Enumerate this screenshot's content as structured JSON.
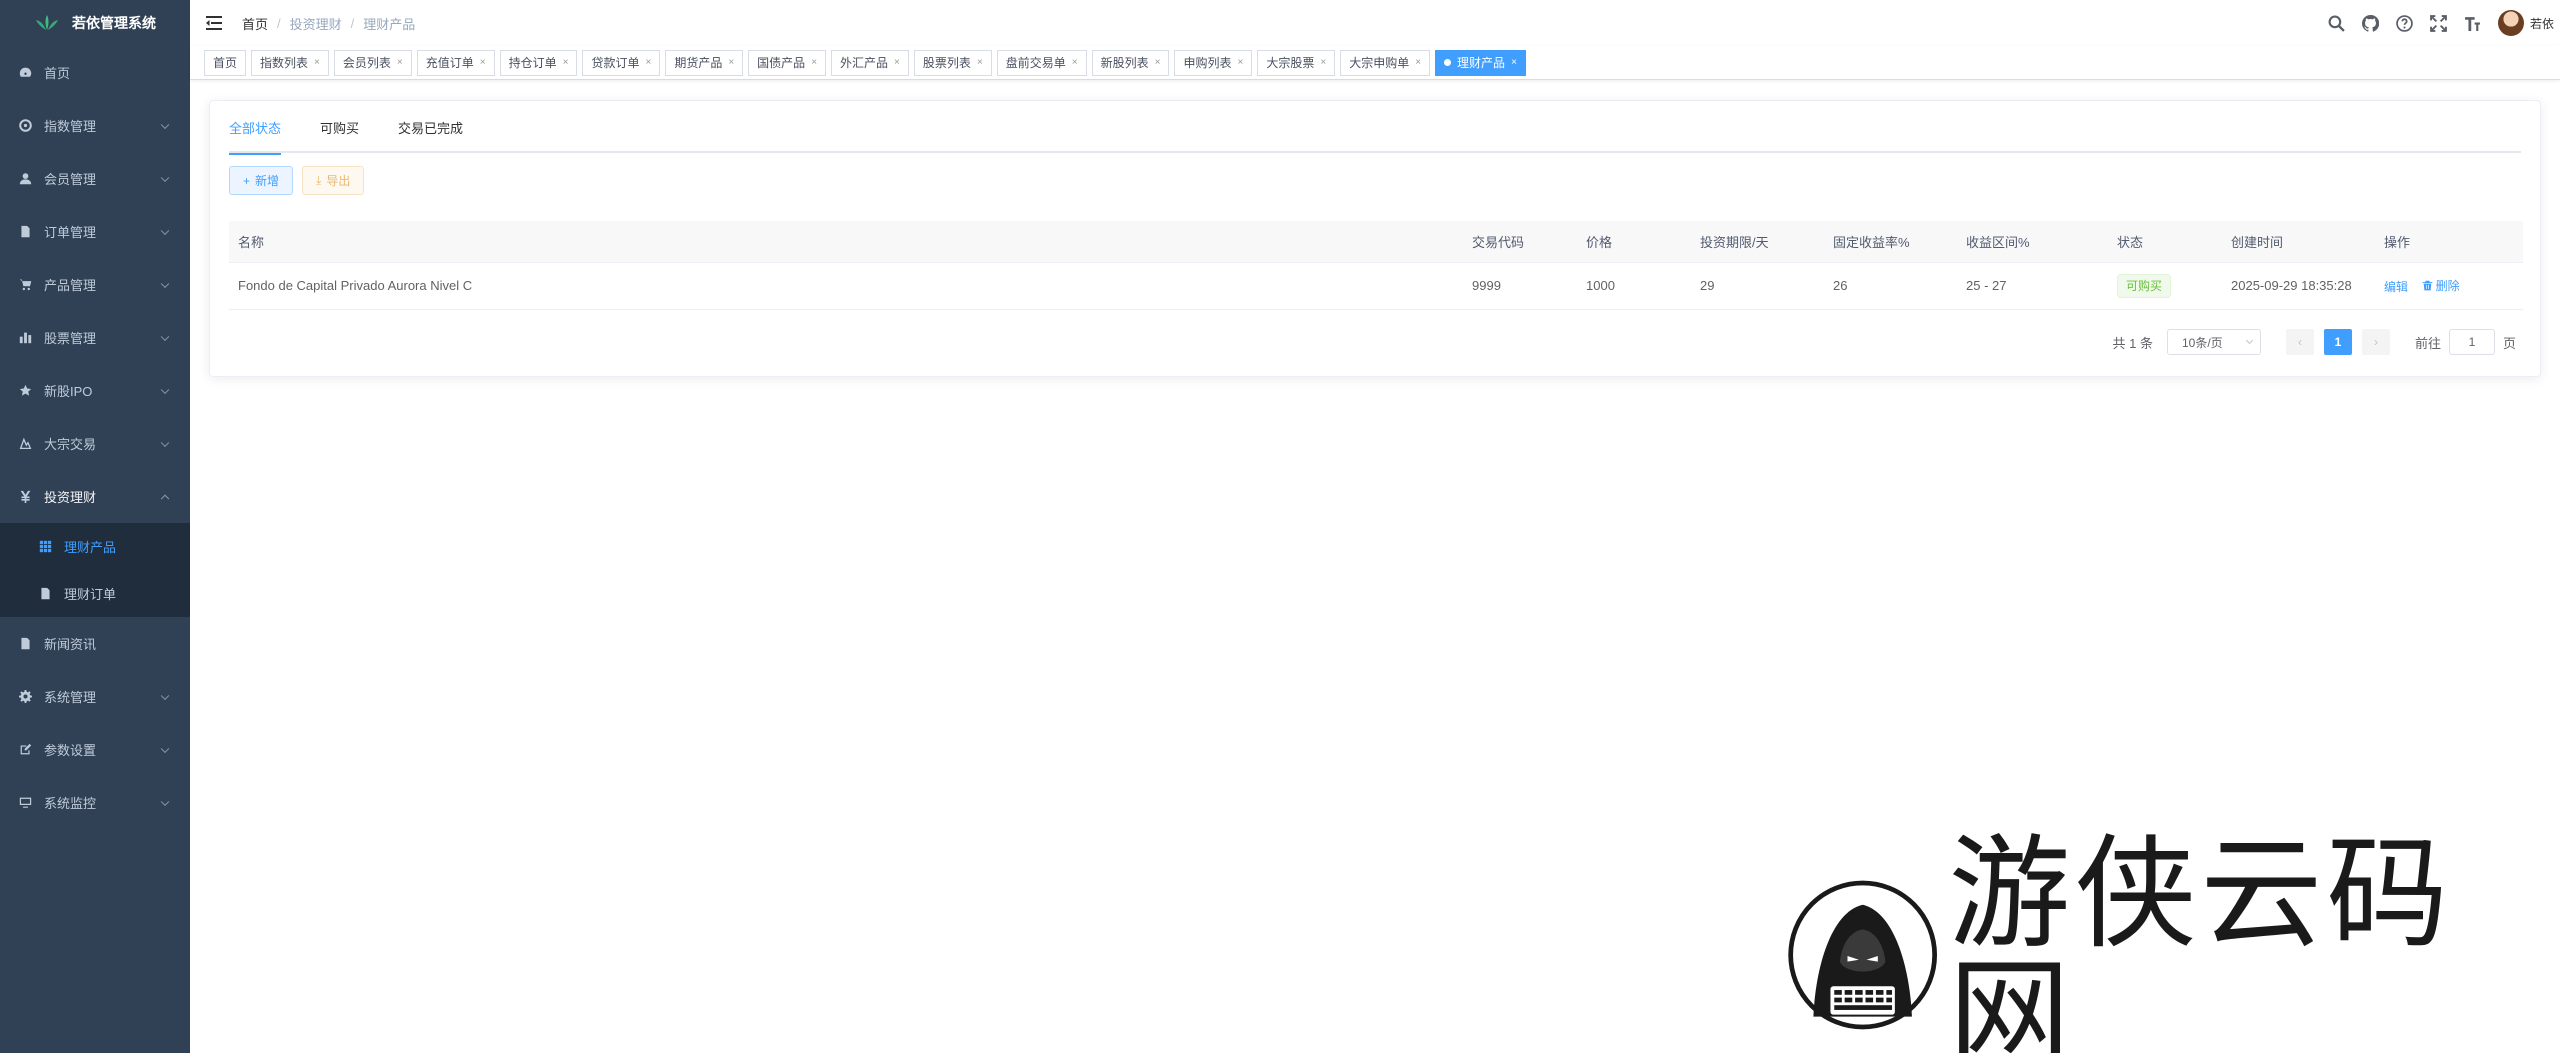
{
  "app": {
    "title": "若依管理系统"
  },
  "sidebar": {
    "items": [
      {
        "label": "首页",
        "icon": "dashboard-icon"
      },
      {
        "label": "指数管理",
        "icon": "index-icon"
      },
      {
        "label": "会员管理",
        "icon": "user-icon"
      },
      {
        "label": "订单管理",
        "icon": "order-icon"
      },
      {
        "label": "产品管理",
        "icon": "cart-icon"
      },
      {
        "label": "股票管理",
        "icon": "chart-icon"
      },
      {
        "label": "新股IPO",
        "icon": "star-icon"
      },
      {
        "label": "大宗交易",
        "icon": "trade-icon"
      },
      {
        "label": "投资理财",
        "icon": "yen-icon"
      },
      {
        "label": "新闻资讯",
        "icon": "news-icon"
      },
      {
        "label": "系统管理",
        "icon": "gear-icon"
      },
      {
        "label": "参数设置",
        "icon": "edit-icon"
      },
      {
        "label": "系统监控",
        "icon": "monitor-icon"
      }
    ],
    "submenu": [
      {
        "label": "理财产品",
        "icon": "grid-icon"
      },
      {
        "label": "理财订单",
        "icon": "doc-icon"
      }
    ]
  },
  "breadcrumb": [
    "首页",
    "投资理财",
    "理财产品"
  ],
  "user": {
    "name": "若依"
  },
  "tags": [
    "首页",
    "指数列表",
    "会员列表",
    "充值订单",
    "持仓订单",
    "贷款订单",
    "期货产品",
    "国债产品",
    "外汇产品",
    "股票列表",
    "盘前交易单",
    "新股列表",
    "申购列表",
    "大宗股票",
    "大宗申购单",
    "理财产品"
  ],
  "tabs": [
    "全部状态",
    "可购买",
    "交易已完成"
  ],
  "toolbar": {
    "add_label": "新增",
    "export_label": "导出"
  },
  "table": {
    "headers": [
      "名称",
      "交易代码",
      "价格",
      "投资期限/天",
      "固定收益率%",
      "收益区间%",
      "状态",
      "创建时间",
      "操作"
    ],
    "rows": [
      {
        "name": "Fondo de Capital Privado Aurora Nivel C",
        "code": "9999",
        "price": "1000",
        "term": "29",
        "rate": "26",
        "range": "25 - 27",
        "status": "可购买",
        "created": "2025-09-29 18:35:28",
        "edit": "编辑",
        "delete": "删除"
      }
    ]
  },
  "pagination": {
    "total": "共 1 条",
    "page_size": "10条/页",
    "current": "1",
    "goto_prefix": "前往",
    "goto_value": "1",
    "goto_suffix": "页"
  },
  "watermark": {
    "text": "游侠云码网"
  },
  "colors": {
    "sidebar_bg": "#304156",
    "accent": "#409eff",
    "success": "#67c23a",
    "warning": "#e6a23c"
  }
}
